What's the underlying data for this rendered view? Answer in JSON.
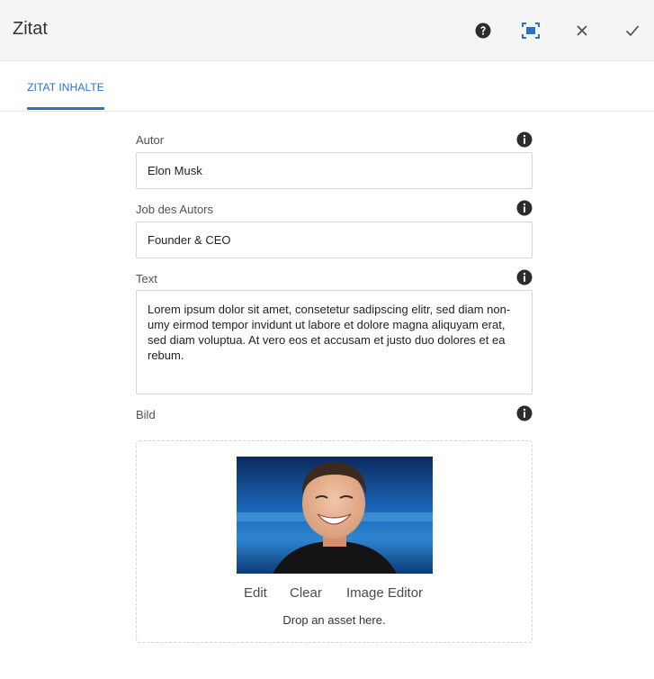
{
  "dialog": {
    "title": "Zitat",
    "toolbar": {
      "help_icon": "question-circle-icon",
      "fullscreen_icon": "fullscreen-icon",
      "close_icon": "close-icon",
      "confirm_icon": "checkmark-icon"
    }
  },
  "tabs": [
    {
      "label": "ZITAT INHALTE",
      "active": true
    }
  ],
  "fields": {
    "author": {
      "label": "Autor",
      "value": "Elon Musk"
    },
    "job": {
      "label": "Job des Autors",
      "value": "Founder & CEO"
    },
    "text": {
      "label": "Text",
      "value": "Lorem ipsum dolor sit amet, consetetur sadipscing elitr, sed diam non-umy eirmod tempor invidunt ut labore et dolore magna aliquyam erat, sed diam voluptua. At vero eos et accusam et justo duo dolores et ea rebum."
    },
    "image": {
      "label": "Bild"
    }
  },
  "asset": {
    "actions": {
      "edit": "Edit",
      "clear": "Clear",
      "editor": "Image Editor"
    },
    "drop_hint": "Drop an asset here."
  },
  "colors": {
    "accent": "#2d71c4",
    "header_bg": "#f5f5f5",
    "icon": "#2c2c2c"
  }
}
